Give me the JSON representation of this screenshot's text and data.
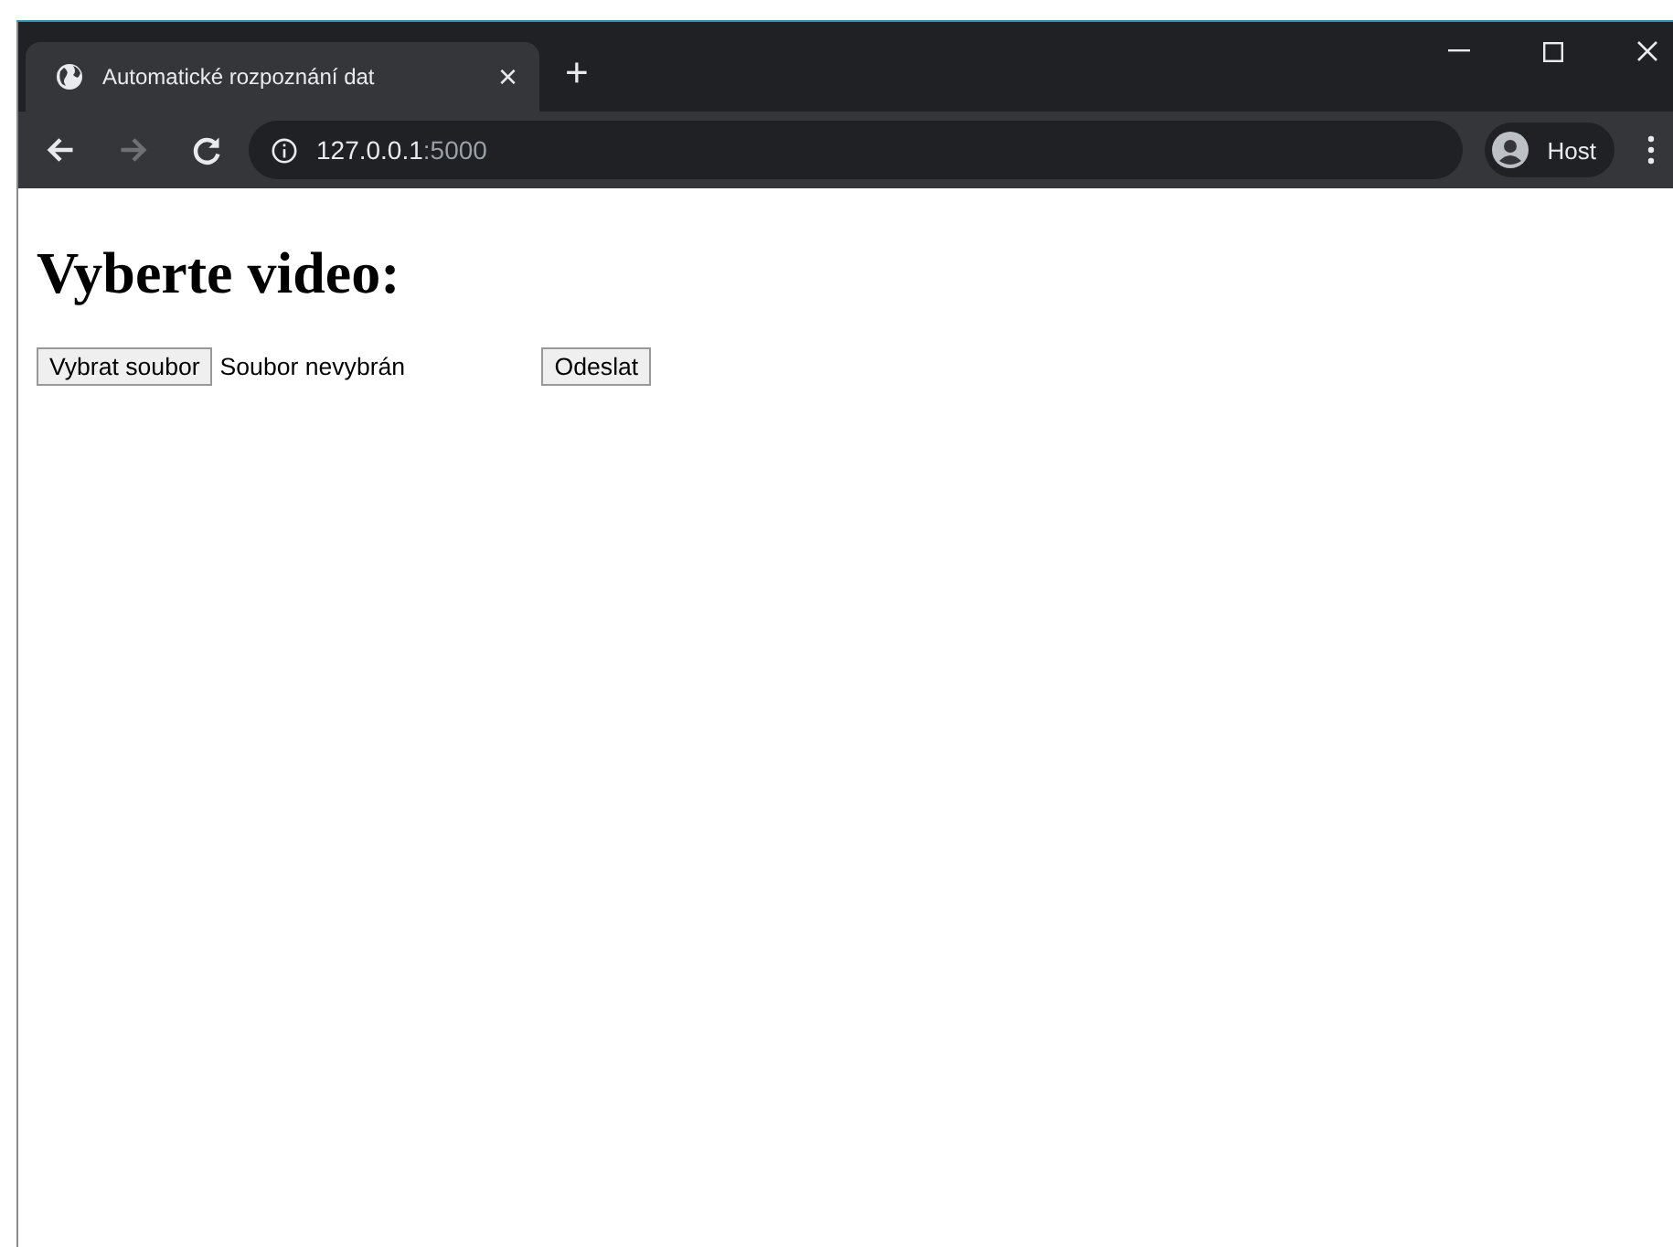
{
  "tab": {
    "title": "Automatické rozpoznání dat",
    "close": "×",
    "new_tab": "+"
  },
  "address_bar": {
    "host": "127.0.0.1",
    "port": ":5000"
  },
  "profile": {
    "label": "Host"
  },
  "page": {
    "heading": "Vyberte video:",
    "file_button": "Vybrat soubor",
    "file_status": "Soubor nevybrán",
    "submit": "Odeslat"
  }
}
